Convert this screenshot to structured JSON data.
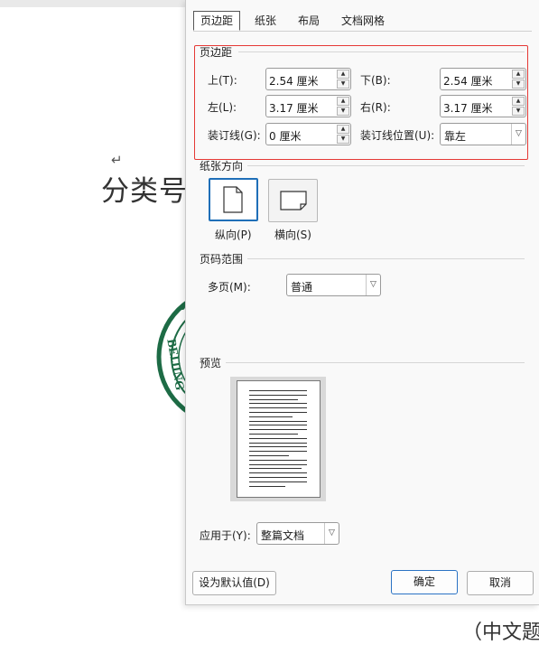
{
  "document": {
    "return_mark": "↵",
    "label": "分类号",
    "bottom_text": "（中文题"
  },
  "tabs": [
    {
      "label": "页边距"
    },
    {
      "label": "纸张"
    },
    {
      "label": "布局"
    },
    {
      "label": "文档网格"
    }
  ],
  "margins": {
    "title": "页边距",
    "top": {
      "label": "上(T):",
      "value": "2.54 厘米"
    },
    "bottom": {
      "label": "下(B):",
      "value": "2.54 厘米"
    },
    "left": {
      "label": "左(L):",
      "value": "3.17 厘米"
    },
    "right": {
      "label": "右(R):",
      "value": "3.17 厘米"
    },
    "gutter": {
      "label": "装订线(G):",
      "value": "0 厘米"
    },
    "gutter_position": {
      "label": "装订线位置(U):",
      "value": "靠左"
    }
  },
  "orientation": {
    "title": "纸张方向",
    "portrait": "纵向(P)",
    "landscape": "横向(S)",
    "selected": "portrait"
  },
  "pages": {
    "title": "页码范围",
    "multiple_label": "多页(M):",
    "multiple_value": "普通"
  },
  "preview": {
    "title": "预览"
  },
  "apply": {
    "label": "应用于(Y):",
    "value": "整篇文档"
  },
  "buttons": {
    "default": "设为默认值(D)",
    "ok": "确定",
    "cancel": "取消"
  },
  "colors": {
    "highlight": "#e53935",
    "selected_orientation": "#1f6fb8",
    "seal": "#1d6b45"
  }
}
